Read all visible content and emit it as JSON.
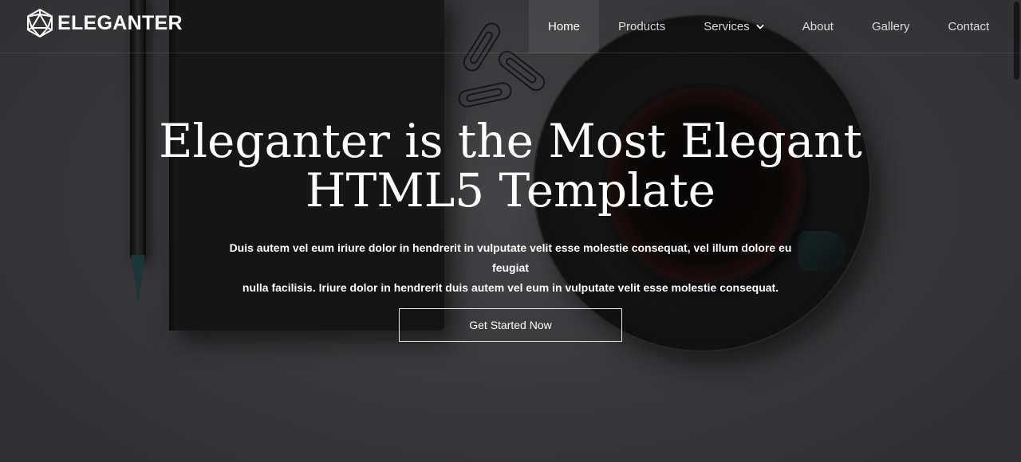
{
  "brand": {
    "name": "ELEGANTER",
    "icon": "polyhedron-logo-icon"
  },
  "nav": {
    "items": [
      {
        "label": "Home",
        "active": true
      },
      {
        "label": "Products",
        "active": false
      },
      {
        "label": "Services",
        "active": false,
        "icon": "chevron-down-icon"
      },
      {
        "label": "About",
        "active": false
      },
      {
        "label": "Gallery",
        "active": false
      },
      {
        "label": "Contact",
        "active": false
      }
    ]
  },
  "hero": {
    "title_line1": "Eleganter is the Most Elegant",
    "title_line2": "HTML5 Template",
    "text_line1": "Duis autem vel eum iriure dolor in hendrerit in vulputate velit esse molestie consequat, vel illum dolore eu feugiat",
    "text_line2": "nulla facilisis. Iriure dolor in hendrerit duis autem vel eum in vulputate velit esse molestie consequat.",
    "cta_label": "Get Started Now"
  },
  "colors": {
    "background": "#3a393c",
    "text": "#ffffff"
  }
}
